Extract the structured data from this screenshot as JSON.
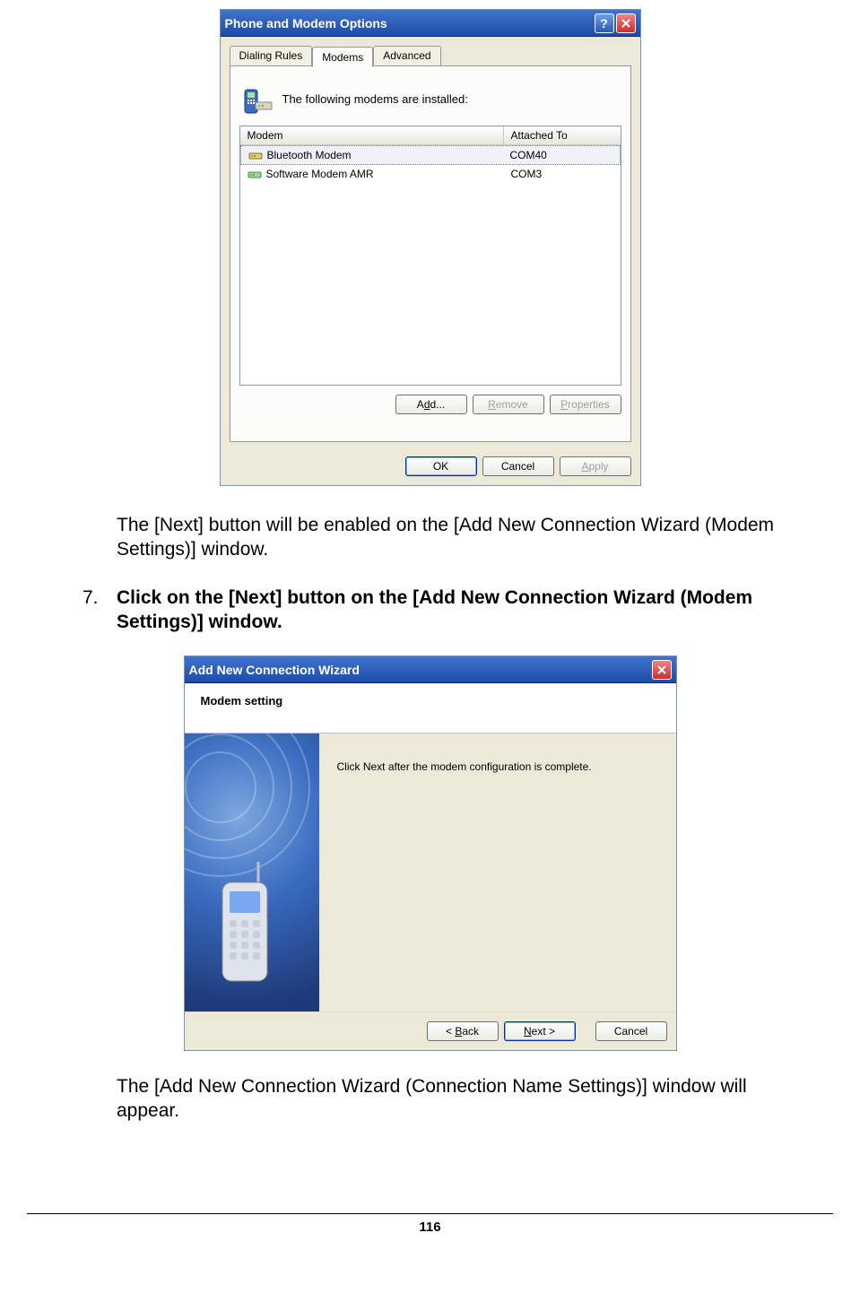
{
  "dialog1": {
    "title": "Phone and Modem Options",
    "tabs": [
      "Dialing Rules",
      "Modems",
      "Advanced"
    ],
    "active_tab_index": 1,
    "intro": "The following modems are installed:",
    "columns": [
      "Modem",
      "Attached To"
    ],
    "rows": [
      {
        "name": "Bluetooth Modem",
        "port": "COM40"
      },
      {
        "name": "Software Modem AMR",
        "port": "COM3"
      }
    ],
    "buttons": {
      "add": "Add...",
      "remove": "Remove",
      "properties": "Properties"
    },
    "footer": {
      "ok": "OK",
      "cancel": "Cancel",
      "apply": "Apply"
    }
  },
  "text1": "The [Next] button will be enabled on the [Add New Connection Wizard (Modem Settings)] window.",
  "step": {
    "number": "7.",
    "text": "Click on the [Next] button on the [Add New Connection Wizard (Modem Settings)] window."
  },
  "dialog2": {
    "title": "Add New Connection Wizard",
    "heading": "Modem setting",
    "instruction": "Click Next after the modem configuration is complete.",
    "buttons": {
      "back": "< Back",
      "next": "Next >",
      "cancel": "Cancel"
    }
  },
  "text2": "The [Add New Connection Wizard (Connection Name Settings)] window will appear.",
  "page_number": "116"
}
